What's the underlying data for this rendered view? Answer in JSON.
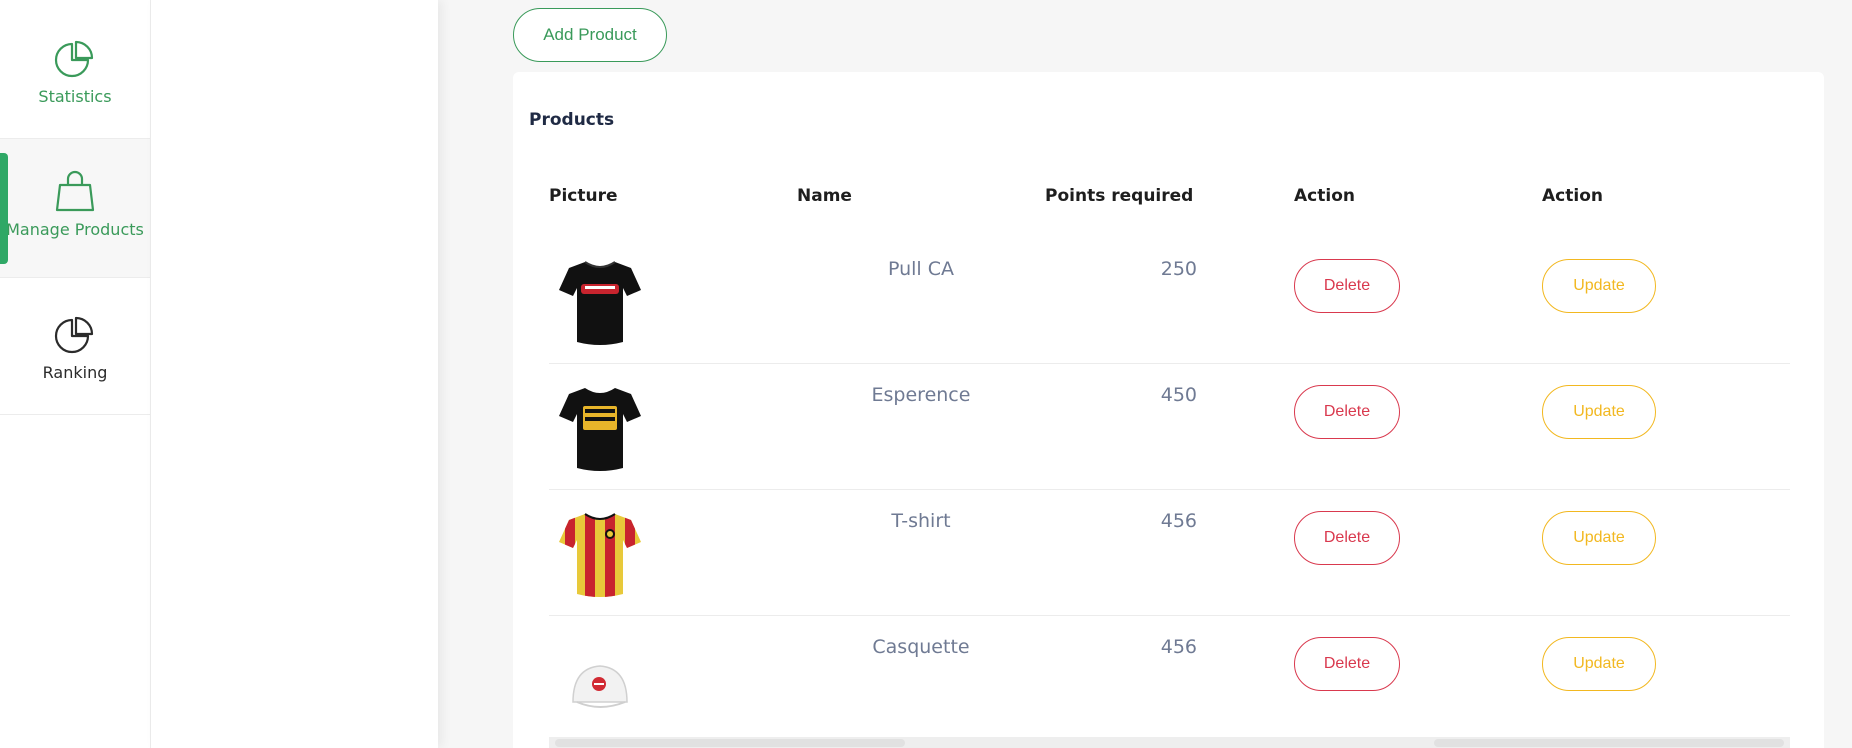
{
  "sidebar": {
    "items": [
      {
        "label": "Statistics",
        "icon": "pie-chart-icon"
      },
      {
        "label": "Manage Products",
        "icon": "shopping-bag-icon"
      },
      {
        "label": "Ranking",
        "icon": "pie-chart-icon"
      }
    ],
    "active": "Manage Products"
  },
  "toolbar": {
    "add_label": "Add Product"
  },
  "products_card": {
    "title": "Products",
    "headers": [
      "Picture",
      "Name",
      "Points required",
      "Action",
      "Action"
    ],
    "rows": [
      {
        "picture": "black-tshirt-red-print",
        "name": "Pull CA",
        "points": "250",
        "delete_label": "Delete",
        "update_label": "Update"
      },
      {
        "picture": "black-tshirt-1919-print",
        "name": "Esperence",
        "points": "450",
        "delete_label": "Delete",
        "update_label": "Update"
      },
      {
        "picture": "red-yellow-striped-jersey",
        "name": "T-shirt",
        "points": "456",
        "delete_label": "Delete",
        "update_label": "Update"
      },
      {
        "picture": "white-cap",
        "name": "Casquette",
        "points": "456",
        "delete_label": "Delete",
        "update_label": "Update"
      }
    ]
  },
  "colors": {
    "accent": "#3a9a5a",
    "active_bar": "#2fa866",
    "delete": "#d9394e",
    "update": "#f2b820",
    "muted_text": "#6f7a93"
  }
}
